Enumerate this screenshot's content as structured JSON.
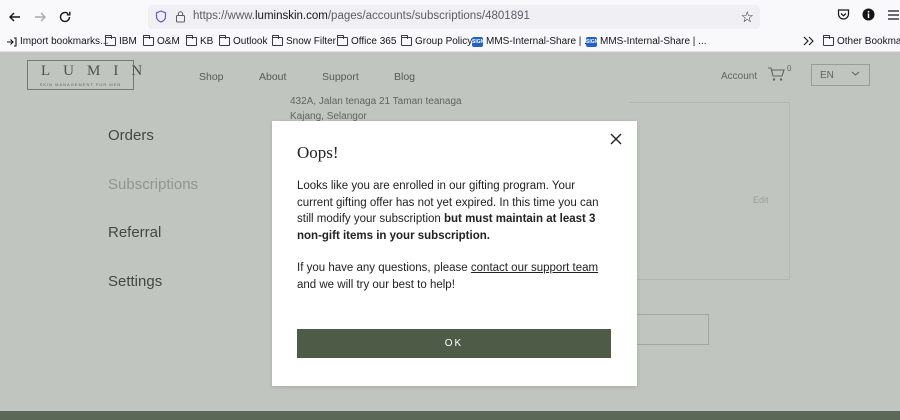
{
  "browser": {
    "url_prefix": "https://www.",
    "url_domain": "luminskin.com",
    "url_path": "/pages/accounts/subscriptions/4801891",
    "bookmarks": [
      {
        "label": "Import bookmarks...",
        "icon": "import-icon"
      },
      {
        "label": "IBM",
        "icon": "folder-icon"
      },
      {
        "label": "O&M",
        "icon": "folder-icon"
      },
      {
        "label": "KB",
        "icon": "folder-icon"
      },
      {
        "label": "Outlook",
        "icon": "folder-icon"
      },
      {
        "label": "Snow Filter",
        "icon": "folder-icon"
      },
      {
        "label": "Office 365",
        "icon": "folder-icon"
      },
      {
        "label": "Group Policy",
        "icon": "folder-icon"
      },
      {
        "label": "MMS-Internal-Share | ...",
        "icon": "sharepoint-icon",
        "icon_text": "SIGN"
      },
      {
        "label": "MMS-Internal-Share | ...",
        "icon": "sharepoint-icon",
        "icon_text": "SIGN"
      },
      {
        "label": "Other Bookmarks",
        "icon": "folder-icon"
      }
    ]
  },
  "site": {
    "logo_word": "LUMIN",
    "logo_tagline": "SKIN MANAGEMENT FOR MEN",
    "menu": [
      "Shop",
      "About",
      "Support",
      "Blog"
    ],
    "account_label": "Account",
    "cart_count": "0",
    "language": "EN"
  },
  "account": {
    "address_line1": "432A, Jalan tenaga 21 Taman teanaga",
    "address_line2": "Kajang, Selangor",
    "nav": [
      "Orders",
      "Subscriptions",
      "Referral",
      "Settings"
    ],
    "active_nav": "Subscriptions",
    "edit_label": "Edit"
  },
  "modal": {
    "title": "Oops!",
    "para1_text": "Looks like you are enrolled in our gifting program. Your current gifting offer has not yet expired. In this time you can still modify your subscription ",
    "para1_bold": "but must maintain at least 3 non-gift items in your subscription.",
    "para2_text": "If you have any questions, please ",
    "para2_link": "contact our support team",
    "para2_end": " and we will try our best to help!",
    "ok_label": "OK"
  },
  "colors": {
    "overlay": "#6c7c6a",
    "button": "#4e5b46"
  }
}
